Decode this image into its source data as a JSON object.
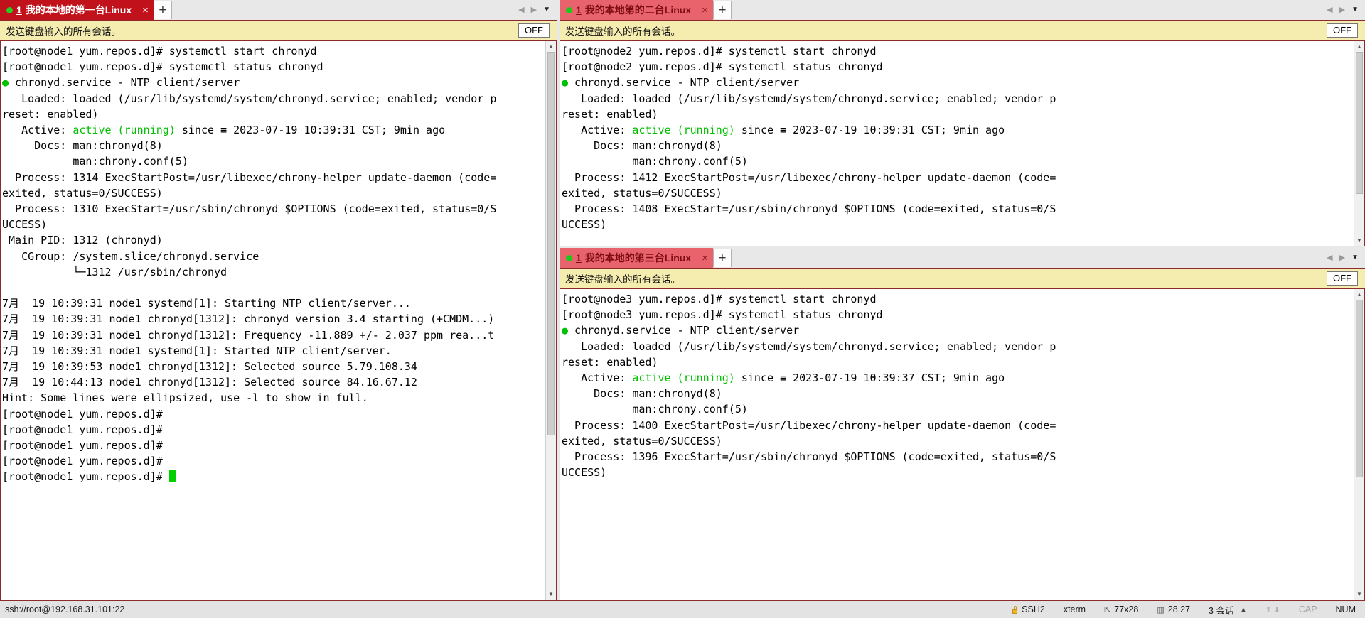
{
  "panes": [
    {
      "id": "pane-1",
      "tab": {
        "index": "1",
        "title": "我的本地的第一台Linux",
        "close": "×",
        "new_tab": "+",
        "state": "active"
      },
      "broadcast": {
        "label": "发送键盘输入的所有会话。",
        "toggle": "OFF"
      },
      "terminal_lines": [
        [
          {
            "t": "[root@node1 yum.repos.d]# systemctl start chronyd"
          }
        ],
        [
          {
            "t": "[root@node1 yum.repos.d]# systemctl status chronyd"
          }
        ],
        [
          {
            "t": "● chronyd.service - NTP client/server",
            "c": "dot-green"
          }
        ],
        [
          {
            "t": "   Loaded: loaded (/usr/lib/systemd/system/chronyd.service; enabled; vendor p"
          }
        ],
        [
          {
            "t": "reset: enabled)"
          }
        ],
        [
          {
            "t": "   Active: "
          },
          {
            "t": "active (running)",
            "c": "green"
          },
          {
            "t": " since ≡ 2023-07-19 10:39:31 CST; 9min ago"
          }
        ],
        [
          {
            "t": "     Docs: man:chronyd(8)"
          }
        ],
        [
          {
            "t": "           man:chrony.conf(5)"
          }
        ],
        [
          {
            "t": "  Process: 1314 ExecStartPost=/usr/libexec/chrony-helper update-daemon (code="
          }
        ],
        [
          {
            "t": "exited, status=0/SUCCESS)"
          }
        ],
        [
          {
            "t": "  Process: 1310 ExecStart=/usr/sbin/chronyd $OPTIONS (code=exited, status=0/S"
          }
        ],
        [
          {
            "t": "UCCESS)"
          }
        ],
        [
          {
            "t": " Main PID: 1312 (chronyd)"
          }
        ],
        [
          {
            "t": "   CGroup: /system.slice/chronyd.service"
          }
        ],
        [
          {
            "t": "           └─1312 /usr/sbin/chronyd"
          }
        ],
        [
          {
            "t": ""
          }
        ],
        [
          {
            "t": "7月  19 10:39:31 node1 systemd[1]: Starting NTP client/server..."
          }
        ],
        [
          {
            "t": "7月  19 10:39:31 node1 chronyd[1312]: chronyd version 3.4 starting (+CMDM...)"
          }
        ],
        [
          {
            "t": "7月  19 10:39:31 node1 chronyd[1312]: Frequency -11.889 +/- 2.037 ppm rea...t"
          }
        ],
        [
          {
            "t": "7月  19 10:39:31 node1 systemd[1]: Started NTP client/server."
          }
        ],
        [
          {
            "t": "7月  19 10:39:53 node1 chronyd[1312]: Selected source 5.79.108.34"
          }
        ],
        [
          {
            "t": "7月  19 10:44:13 node1 chronyd[1312]: Selected source 84.16.67.12"
          }
        ],
        [
          {
            "t": "Hint: Some lines were ellipsized, use -l to show in full."
          }
        ],
        [
          {
            "t": "[root@node1 yum.repos.d]#"
          }
        ],
        [
          {
            "t": "[root@node1 yum.repos.d]#"
          }
        ],
        [
          {
            "t": "[root@node1 yum.repos.d]#"
          }
        ],
        [
          {
            "t": "[root@node1 yum.repos.d]#"
          }
        ],
        [
          {
            "t": "[root@node1 yum.repos.d]# ",
            "cursor": true
          }
        ]
      ]
    },
    {
      "id": "pane-2",
      "tab": {
        "index": "1",
        "title": "我的本地第的二台Linux",
        "close": "×",
        "new_tab": "+",
        "state": "inactive"
      },
      "broadcast": {
        "label": "发送键盘输入的所有会话。",
        "toggle": "OFF"
      },
      "terminal_lines": [
        [
          {
            "t": "[root@node2 yum.repos.d]# systemctl start chronyd"
          }
        ],
        [
          {
            "t": "[root@node2 yum.repos.d]# systemctl status chronyd"
          }
        ],
        [
          {
            "t": "● chronyd.service - NTP client/server",
            "c": "dot-green"
          }
        ],
        [
          {
            "t": "   Loaded: loaded (/usr/lib/systemd/system/chronyd.service; enabled; vendor p"
          }
        ],
        [
          {
            "t": "reset: enabled)"
          }
        ],
        [
          {
            "t": "   Active: "
          },
          {
            "t": "active (running)",
            "c": "green"
          },
          {
            "t": " since ≡ 2023-07-19 10:39:31 CST; 9min ago"
          }
        ],
        [
          {
            "t": "     Docs: man:chronyd(8)"
          }
        ],
        [
          {
            "t": "           man:chrony.conf(5)"
          }
        ],
        [
          {
            "t": "  Process: 1412 ExecStartPost=/usr/libexec/chrony-helper update-daemon (code="
          }
        ],
        [
          {
            "t": "exited, status=0/SUCCESS)"
          }
        ],
        [
          {
            "t": "  Process: 1408 ExecStart=/usr/sbin/chronyd $OPTIONS (code=exited, status=0/S"
          }
        ],
        [
          {
            "t": "UCCESS)"
          }
        ]
      ]
    },
    {
      "id": "pane-3",
      "tab": {
        "index": "1",
        "title": "我的本地的第三台Linux",
        "close": "×",
        "new_tab": "+",
        "state": "inactive"
      },
      "broadcast": {
        "label": "发送键盘输入的所有会话。",
        "toggle": "OFF"
      },
      "terminal_lines": [
        [
          {
            "t": "[root@node3 yum.repos.d]# systemctl start chronyd"
          }
        ],
        [
          {
            "t": "[root@node3 yum.repos.d]# systemctl status chronyd"
          }
        ],
        [
          {
            "t": "● chronyd.service - NTP client/server",
            "c": "dot-green"
          }
        ],
        [
          {
            "t": "   Loaded: loaded (/usr/lib/systemd/system/chronyd.service; enabled; vendor p"
          }
        ],
        [
          {
            "t": "reset: enabled)"
          }
        ],
        [
          {
            "t": "   Active: "
          },
          {
            "t": "active (running)",
            "c": "green"
          },
          {
            "t": " since ≡ 2023-07-19 10:39:37 CST; 9min ago"
          }
        ],
        [
          {
            "t": "     Docs: man:chronyd(8)"
          }
        ],
        [
          {
            "t": "           man:chrony.conf(5)"
          }
        ],
        [
          {
            "t": "  Process: 1400 ExecStartPost=/usr/libexec/chrony-helper update-daemon (code="
          }
        ],
        [
          {
            "t": "exited, status=0/SUCCESS)"
          }
        ],
        [
          {
            "t": "  Process: 1396 ExecStart=/usr/sbin/chronyd $OPTIONS (code=exited, status=0/S"
          }
        ],
        [
          {
            "t": "UCCESS)"
          }
        ]
      ]
    }
  ],
  "status_bar": {
    "connection": "ssh://root@192.168.31.101:22",
    "protocol": "SSH2",
    "terminal_type": "xterm",
    "size": "77x28",
    "cursor_position": "28,27",
    "sessions": "3 会话",
    "cap": "CAP",
    "num": "NUM"
  },
  "colors": {
    "tab_active": "#c1121c",
    "tab_inactive": "#e8636b",
    "broadcast_bg": "#f5edaf",
    "terminal_green": "#00c000",
    "border": "#8c2b2b"
  }
}
